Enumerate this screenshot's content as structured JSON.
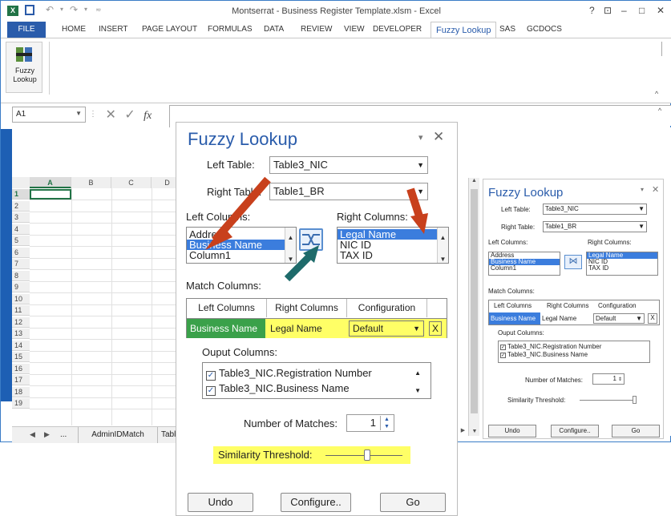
{
  "window": {
    "title": "Montserrat - Business Register Template.xlsm - Excel",
    "help": "?",
    "restore": "⊡",
    "minimize": "–",
    "maximize": "□",
    "close": "✕"
  },
  "ribbon": {
    "tabs": [
      "FILE",
      "HOME",
      "INSERT",
      "PAGE LAYOUT",
      "FORMULAS",
      "DATA",
      "REVIEW",
      "VIEW",
      "DEVELOPER",
      "Fuzzy Lookup",
      "SAS",
      "GCDOCS"
    ],
    "active_tab": "Fuzzy Lookup",
    "button_label": "Fuzzy Lookup"
  },
  "formula_bar": {
    "name_box": "A1",
    "fx": "fx"
  },
  "grid": {
    "columns": [
      "A",
      "B",
      "C",
      "D"
    ],
    "rows": [
      "1",
      "2",
      "3",
      "4",
      "5",
      "6",
      "7",
      "8",
      "9",
      "10",
      "11",
      "12",
      "13",
      "14",
      "15",
      "16",
      "17",
      "18",
      "19"
    ]
  },
  "sheet_tabs": {
    "ellipsis": "...",
    "tab1": "AdminIDMatch",
    "tab2": "Table"
  },
  "main_pane": {
    "title": "Fuzzy Lookup",
    "left_table_label": "Left Table:",
    "left_table_value": "Table3_NIC",
    "right_table_label": "Right Table:",
    "right_table_value": "Table1_BR",
    "left_columns_label": "Left Columns:",
    "right_columns_label": "Right Columns:",
    "left_columns": [
      "Address",
      "Business Name",
      "Column1"
    ],
    "left_selected": "Business Name",
    "right_columns": [
      "Legal Name",
      "NIC ID",
      "TAX ID"
    ],
    "right_selected": "Legal Name",
    "match_columns_label": "Match Columns:",
    "match_headers": [
      "Left Columns",
      "Right Columns",
      "Configuration"
    ],
    "match_row": {
      "left": "Business Name",
      "right": "Legal Name",
      "config": "Default",
      "remove": "X"
    },
    "output_columns_label": "Ouput Columns:",
    "output_columns": [
      "Table3_NIC.Registration Number",
      "Table3_NIC.Business Name"
    ],
    "num_matches_label": "Number of Matches:",
    "num_matches": "1",
    "similarity_label": "Similarity Threshold:",
    "undo": "Undo",
    "configure": "Configure..",
    "go": "Go"
  },
  "small_pane": {
    "title": "Fuzzy Lookup",
    "left_table_label": "Left Table:",
    "left_table_value": "Table3_NIC",
    "right_table_label": "Right Table:",
    "right_table_value": "Table1_BR",
    "left_columns_label": "Left Columns:",
    "right_columns_label": "Right Columns:",
    "left_columns": [
      "Address",
      "Business Name",
      "Column1"
    ],
    "right_columns": [
      "Legal Name",
      "NIC ID",
      "TAX ID"
    ],
    "match_columns_label": "Match Columns:",
    "match_headers": [
      "Left Columns",
      "Right Columns",
      "Configuration"
    ],
    "match_row": {
      "left": "Business Name",
      "right": "Legal Name",
      "config": "Default",
      "remove": "X"
    },
    "output_columns_label": "Ouput Columns:",
    "output_columns": [
      "Table3_NIC.Registration Number",
      "Table3_NIC.Business Name"
    ],
    "num_matches_label": "Number of Matches:",
    "num_matches": "1",
    "similarity_label": "Similarity Threshold:",
    "undo": "Undo",
    "configure": "Configure..",
    "go": "Go"
  },
  "colors": {
    "accent": "#2a5cab",
    "excel_green": "#217346",
    "highlight_yellow": "#ffff66",
    "match_green": "#3aa14a",
    "arrow_red": "#c8401c",
    "arrow_teal": "#1e6b6b"
  }
}
